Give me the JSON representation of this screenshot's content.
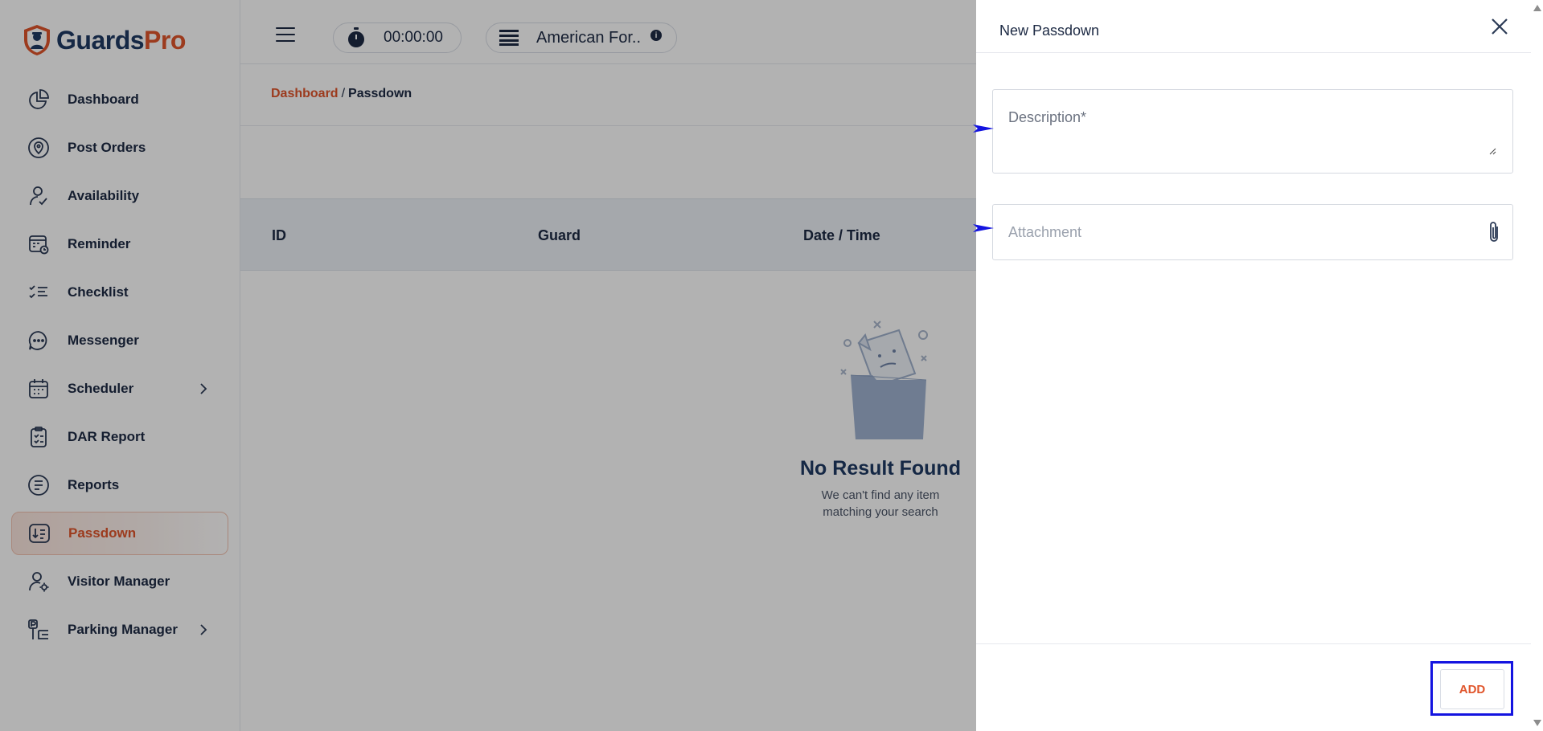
{
  "brand": {
    "part1": "Guards",
    "part2": "Pro",
    "primary_color": "#1f3a63",
    "accent_color": "#e0552b"
  },
  "sidebar": {
    "items": [
      {
        "label": "Dashboard",
        "icon": "pie-chart-icon",
        "active": false,
        "has_submenu": false
      },
      {
        "label": "Post Orders",
        "icon": "location-pin-icon",
        "active": false,
        "has_submenu": false
      },
      {
        "label": "Availability",
        "icon": "user-check-icon",
        "active": false,
        "has_submenu": false
      },
      {
        "label": "Reminder",
        "icon": "calendar-clock-icon",
        "active": false,
        "has_submenu": false
      },
      {
        "label": "Checklist",
        "icon": "checklist-icon",
        "active": false,
        "has_submenu": false
      },
      {
        "label": "Messenger",
        "icon": "chat-bubble-icon",
        "active": false,
        "has_submenu": false
      },
      {
        "label": "Scheduler",
        "icon": "calendar-icon",
        "active": false,
        "has_submenu": true
      },
      {
        "label": "DAR Report",
        "icon": "clipboard-check-icon",
        "active": false,
        "has_submenu": false
      },
      {
        "label": "Reports",
        "icon": "document-list-icon",
        "active": false,
        "has_submenu": false
      },
      {
        "label": "Passdown",
        "icon": "passdown-icon",
        "active": true,
        "has_submenu": false
      },
      {
        "label": "Visitor Manager",
        "icon": "user-gear-icon",
        "active": false,
        "has_submenu": false
      },
      {
        "label": "Parking Manager",
        "icon": "parking-icon",
        "active": false,
        "has_submenu": true
      }
    ]
  },
  "topbar": {
    "timer": "00:00:00",
    "site_name": "American For.."
  },
  "breadcrumb": {
    "parent": "Dashboard",
    "separator": "/",
    "current": "Passdown"
  },
  "table": {
    "columns": [
      "ID",
      "Guard",
      "Date / Time"
    ]
  },
  "empty_state": {
    "title": "No Result Found",
    "subtitle_line1": "We can't find any item",
    "subtitle_line2": "matching your search"
  },
  "drawer": {
    "title": "New Passdown",
    "description_placeholder": "Description*",
    "attachment_placeholder": "Attachment",
    "add_label": "ADD"
  }
}
